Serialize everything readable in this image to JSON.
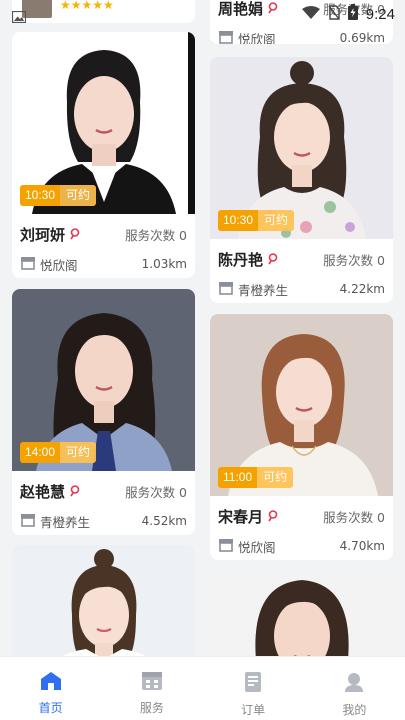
{
  "status": {
    "time": "9:24"
  },
  "top_partial": {
    "left_stars": "★★★★★",
    "right_name": "周艳娟",
    "right_count": "服务次数 0",
    "right_location": "悦欣阁",
    "right_distance": "0.69km"
  },
  "cards": [
    {
      "name": "刘珂妍",
      "count": "服务次数 0",
      "location": "悦欣阁",
      "distance": "1.03km",
      "time": "10:30",
      "status": "可约"
    },
    {
      "name": "陈丹艳",
      "count": "服务次数 0",
      "location": "青橙养生",
      "distance": "4.22km",
      "time": "10:30",
      "status": "可约"
    },
    {
      "name": "赵艳慧",
      "count": "服务次数 0",
      "location": "青橙养生",
      "distance": "4.52km",
      "time": "14:00",
      "status": "可约"
    },
    {
      "name": "宋春月",
      "count": "服务次数 0",
      "location": "悦欣阁",
      "distance": "4.70km",
      "time": "11:00",
      "status": "可约"
    }
  ],
  "tabs": [
    {
      "label": "首页",
      "icon": "home-icon",
      "active": true
    },
    {
      "label": "服务",
      "icon": "grid-icon",
      "active": false
    },
    {
      "label": "订单",
      "icon": "document-icon",
      "active": false
    },
    {
      "label": "我的",
      "icon": "person-icon",
      "active": false
    }
  ],
  "colors": {
    "accent": "#2f6ff0",
    "badge": "#f5a200",
    "pin": "#e8344e"
  }
}
